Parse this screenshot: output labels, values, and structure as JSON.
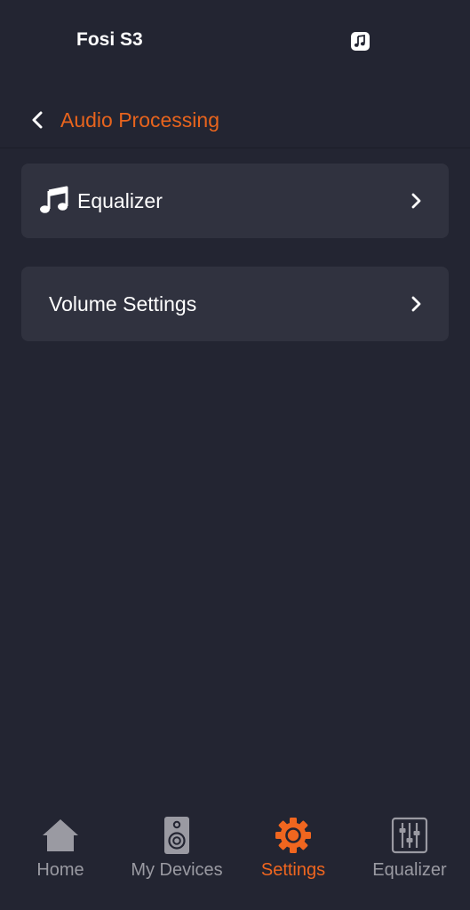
{
  "status_bar": {
    "device_name": "Fosi S3",
    "app_icon": "music-note-icon"
  },
  "header": {
    "back_icon": "chevron-left-icon",
    "title": "Audio Processing"
  },
  "menu": [
    {
      "label": "Equalizer",
      "icon": "music-note-icon",
      "chevron": "chevron-right-icon"
    },
    {
      "label": "Volume Settings",
      "chevron": "chevron-right-icon"
    }
  ],
  "tabs": [
    {
      "label": "Home",
      "icon": "home-icon",
      "active": false
    },
    {
      "label": "My Devices",
      "icon": "speaker-icon",
      "active": false
    },
    {
      "label": "Settings",
      "icon": "gear-icon",
      "active": true
    },
    {
      "label": "Equalizer",
      "icon": "equalizer-sliders-icon",
      "active": false
    }
  ],
  "colors": {
    "background": "#232532",
    "card": "#30323f",
    "accent": "#e8641d",
    "inactive": "#9a9aa2"
  }
}
